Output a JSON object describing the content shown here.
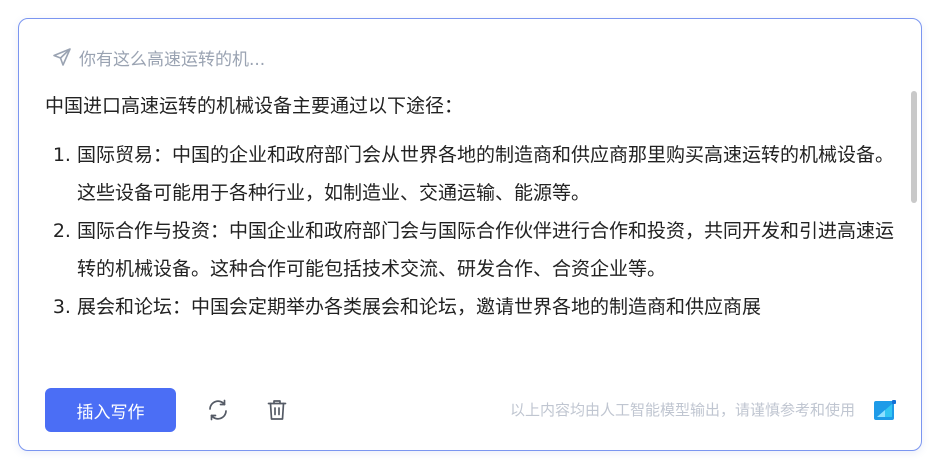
{
  "prompt": {
    "icon": "send-icon",
    "text": "你有这么高速运转的机..."
  },
  "response": {
    "intro": "中国进口高速运转的机械设备主要通过以下途径：",
    "items": [
      "国际贸易：中国的企业和政府部门会从世界各地的制造商和供应商那里购买高速运转的机械设备。这些设备可能用于各种行业，如制造业、交通运输、能源等。",
      "国际合作与投资：中国企业和政府部门会与国际合作伙伴进行合作和投资，共同开发和引进高速运转的机械设备。这种合作可能包括技术交流、研发合作、合资企业等。",
      "展会和论坛：中国会定期举办各类展会和论坛，邀请世界各地的制造商和供应商展"
    ]
  },
  "footer": {
    "insert_label": "插入写作",
    "refresh_icon": "refresh-icon",
    "delete_icon": "trash-icon",
    "disclaimer": "以上内容均由人工智能模型输出，请谨慎参考和使用",
    "logo_icon": "ai-logo-icon"
  },
  "colors": {
    "accent": "#4b6ef5",
    "border": "#7b96f0",
    "muted_text": "#9aa3b2",
    "disclaimer_text": "#c0c6d1"
  }
}
